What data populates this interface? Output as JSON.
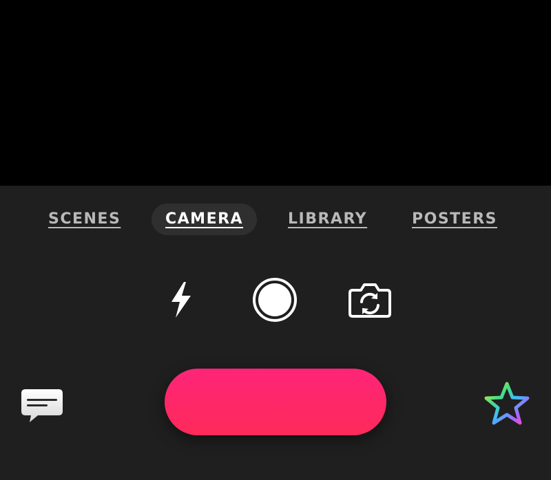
{
  "tabs": [
    {
      "label": "SCENES",
      "active": false
    },
    {
      "label": "CAMERA",
      "active": true
    },
    {
      "label": "LIBRARY",
      "active": false
    },
    {
      "label": "POSTERS",
      "active": false
    }
  ],
  "icons": {
    "flash": "flash-icon",
    "mode": "circle-mode-icon",
    "flip": "camera-flip-icon",
    "comment": "speech-bubble-icon",
    "favorites": "rainbow-star-icon"
  },
  "colors": {
    "viewfinder": "#000000",
    "panel": "#1f1f1f",
    "active_tab_bg": "#2f2f2f",
    "record_button_top": "#fe2578",
    "record_button_bottom": "#fe2a5a"
  }
}
